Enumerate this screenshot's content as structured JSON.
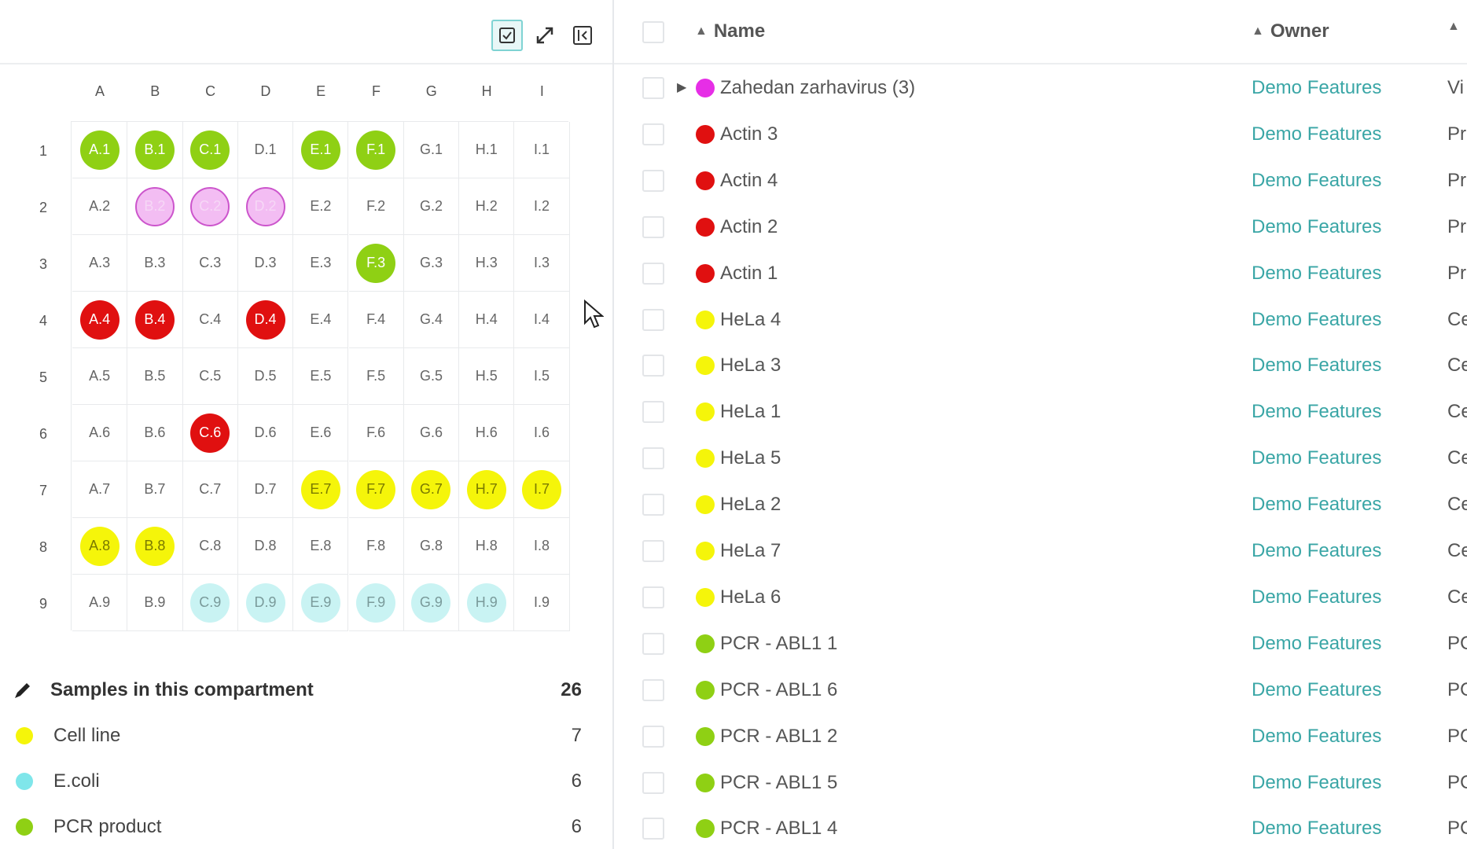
{
  "colors": {
    "pcr": "#8fd014",
    "virus": "#f3bdf3",
    "virus_border": "#cc55cc",
    "actin": "#e01010",
    "cell_line": "#f5f50a",
    "ecoli": "#c9f3f3",
    "ecoli_legend": "#7fe6ea",
    "zahedan": "#e62ee6",
    "owner_link": "#3aa6a6"
  },
  "toolbar": {
    "select_icon": "checkbox-icon",
    "expand_icon": "expand-icon",
    "collapse_icon": "collapse-panel-icon"
  },
  "plate": {
    "columns": [
      "A",
      "B",
      "C",
      "D",
      "E",
      "F",
      "G",
      "H",
      "I"
    ],
    "rows": [
      "1",
      "2",
      "3",
      "4",
      "5",
      "6",
      "7",
      "8",
      "9"
    ],
    "cells": [
      [
        "A.1",
        "B.1",
        "C.1",
        "D.1",
        "E.1",
        "F.1",
        "G.1",
        "H.1",
        "I.1"
      ],
      [
        "A.2",
        "B.2",
        "C.2",
        "D.2",
        "E.2",
        "F.2",
        "G.2",
        "H.2",
        "I.2"
      ],
      [
        "A.3",
        "B.3",
        "C.3",
        "D.3",
        "E.3",
        "F.3",
        "G.3",
        "H.3",
        "I.3"
      ],
      [
        "A.4",
        "B.4",
        "C.4",
        "D.4",
        "E.4",
        "F.4",
        "G.4",
        "H.4",
        "I.4"
      ],
      [
        "A.5",
        "B.5",
        "C.5",
        "D.5",
        "E.5",
        "F.5",
        "G.5",
        "H.5",
        "I.5"
      ],
      [
        "A.6",
        "B.6",
        "C.6",
        "D.6",
        "E.6",
        "F.6",
        "G.6",
        "H.6",
        "I.6"
      ],
      [
        "A.7",
        "B.7",
        "C.7",
        "D.7",
        "E.7",
        "F.7",
        "G.7",
        "H.7",
        "I.7"
      ],
      [
        "A.8",
        "B.8",
        "C.8",
        "D.8",
        "E.8",
        "F.8",
        "G.8",
        "H.8",
        "I.8"
      ],
      [
        "A.9",
        "B.9",
        "C.9",
        "D.9",
        "E.9",
        "F.9",
        "G.9",
        "H.9",
        "I.9"
      ]
    ],
    "types": [
      [
        "pcr",
        "pcr",
        "pcr",
        "",
        "pcr",
        "pcr",
        "",
        "",
        ""
      ],
      [
        "",
        "virus",
        "virus",
        "virus",
        "",
        "",
        "",
        "",
        ""
      ],
      [
        "",
        "",
        "",
        "",
        "",
        "pcr",
        "",
        "",
        ""
      ],
      [
        "actin",
        "actin",
        "",
        "actin",
        "",
        "",
        "",
        "",
        ""
      ],
      [
        "",
        "",
        "",
        "",
        "",
        "",
        "",
        "",
        ""
      ],
      [
        "",
        "",
        "actin",
        "",
        "",
        "",
        "",
        "",
        ""
      ],
      [
        "",
        "",
        "",
        "",
        "cell_line",
        "cell_line",
        "cell_line",
        "cell_line",
        "cell_line"
      ],
      [
        "cell_line",
        "cell_line",
        "",
        "",
        "",
        "",
        "",
        "",
        ""
      ],
      [
        "",
        "",
        "ecoli",
        "ecoli",
        "ecoli",
        "ecoli",
        "ecoli",
        "ecoli",
        ""
      ]
    ]
  },
  "legend": {
    "header_icon": "pencil-icon",
    "header_label": "Samples in this compartment",
    "header_count": "26",
    "items": [
      {
        "label": "Cell line",
        "count": "7",
        "color": "#f5f50a"
      },
      {
        "label": "E.coli",
        "count": "6",
        "color": "#7fe6ea"
      },
      {
        "label": "PCR product",
        "count": "6",
        "color": "#8fd014"
      }
    ]
  },
  "table": {
    "headers": {
      "name": "Name",
      "owner": "Owner",
      "type": "↕"
    },
    "rows": [
      {
        "name": "Zahedan zarhavirus (3)",
        "owner": "Demo Features",
        "type": "Vi",
        "color": "#e62ee6",
        "expandable": true
      },
      {
        "name": "Actin 3",
        "owner": "Demo Features",
        "type": "Pr",
        "color": "#e01010"
      },
      {
        "name": "Actin 4",
        "owner": "Demo Features",
        "type": "Pr",
        "color": "#e01010"
      },
      {
        "name": "Actin 2",
        "owner": "Demo Features",
        "type": "Pr",
        "color": "#e01010"
      },
      {
        "name": "Actin 1",
        "owner": "Demo Features",
        "type": "Pr",
        "color": "#e01010"
      },
      {
        "name": "HeLa 4",
        "owner": "Demo Features",
        "type": "Ce",
        "color": "#f5f50a"
      },
      {
        "name": "HeLa 3",
        "owner": "Demo Features",
        "type": "Ce",
        "color": "#f5f50a"
      },
      {
        "name": "HeLa 1",
        "owner": "Demo Features",
        "type": "Ce",
        "color": "#f5f50a"
      },
      {
        "name": "HeLa 5",
        "owner": "Demo Features",
        "type": "Ce",
        "color": "#f5f50a"
      },
      {
        "name": "HeLa 2",
        "owner": "Demo Features",
        "type": "Ce",
        "color": "#f5f50a"
      },
      {
        "name": "HeLa 7",
        "owner": "Demo Features",
        "type": "Ce",
        "color": "#f5f50a"
      },
      {
        "name": "HeLa 6",
        "owner": "Demo Features",
        "type": "Ce",
        "color": "#f5f50a"
      },
      {
        "name": "PCR - ABL1 1",
        "owner": "Demo Features",
        "type": "PC",
        "color": "#8fd014"
      },
      {
        "name": "PCR - ABL1 6",
        "owner": "Demo Features",
        "type": "PC",
        "color": "#8fd014"
      },
      {
        "name": "PCR - ABL1 2",
        "owner": "Demo Features",
        "type": "PC",
        "color": "#8fd014"
      },
      {
        "name": "PCR - ABL1 5",
        "owner": "Demo Features",
        "type": "PC",
        "color": "#8fd014"
      },
      {
        "name": "PCR - ABL1 4",
        "owner": "Demo Features",
        "type": "PC",
        "color": "#8fd014"
      }
    ]
  }
}
